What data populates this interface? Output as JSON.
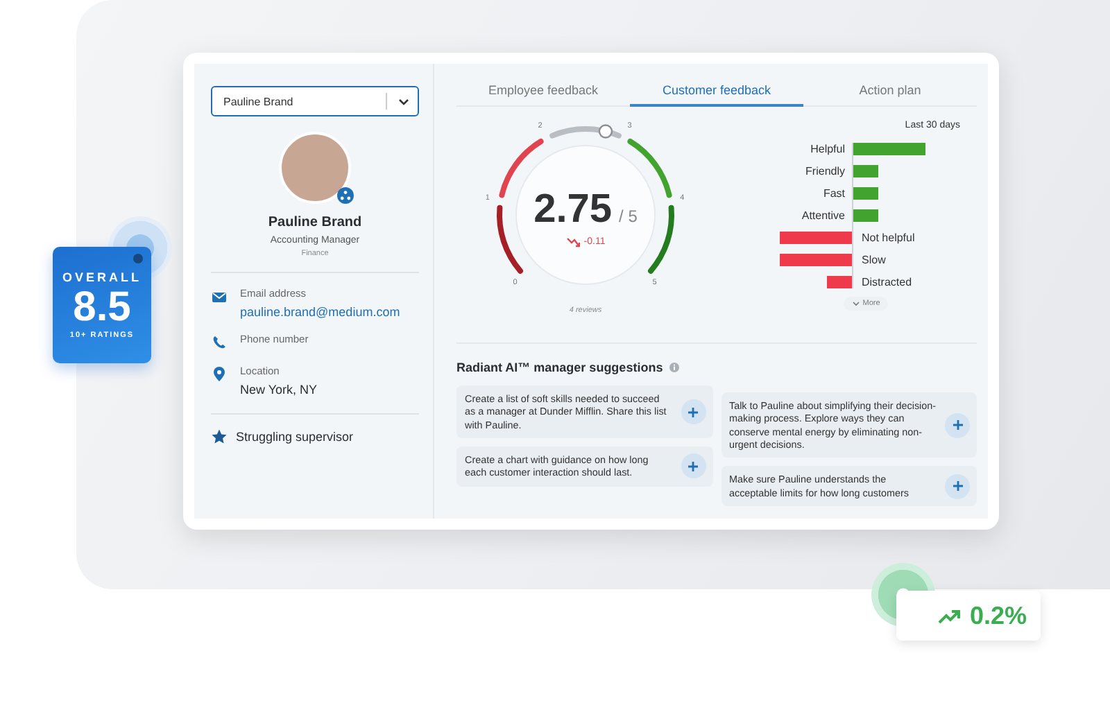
{
  "profile_picker": {
    "value": "Pauline Brand"
  },
  "profile": {
    "name": "Pauline Brand",
    "title": "Accounting Manager",
    "department": "Finance"
  },
  "contacts": [
    {
      "kind": "email",
      "label": "Email address",
      "value": "pauline.brand@medium.com"
    },
    {
      "kind": "phone",
      "label": "Phone number"
    },
    {
      "kind": "location",
      "label": "Location",
      "value": "New York, NY"
    }
  ],
  "flag": {
    "label": "Struggling supervisor"
  },
  "tabs": [
    {
      "label": "Employee feedback",
      "selected": false
    },
    {
      "label": "Customer feedback",
      "selected": true
    },
    {
      "label": "Action plan",
      "selected": false
    }
  ],
  "gauge": {
    "score": "2.75",
    "max": "/ 5",
    "level": 0.55,
    "change": "-0.11",
    "reviews": "4 reviews",
    "ticks": [
      "0",
      "1",
      "2",
      "3",
      "4",
      "5"
    ]
  },
  "traits": {
    "period": "Last 30 days",
    "more": "More",
    "items": [
      {
        "label": "Helpful",
        "kind": "positive"
      },
      {
        "label": "Friendly",
        "kind": "positive"
      },
      {
        "label": "Fast",
        "kind": "positive"
      },
      {
        "label": "Attentive",
        "kind": "positive"
      },
      {
        "label": "Not helpful",
        "kind": "negative"
      },
      {
        "label": "Slow",
        "kind": "negative"
      },
      {
        "label": "Distracted",
        "kind": "negative"
      }
    ]
  },
  "suggestions": {
    "title": "Radiant AI™ manager suggestions",
    "columns": [
      [
        "Create a list of soft skills needed to succeed as a manager at Dunder Mifflin. Share this list with Pauline.",
        "Create a chart with guidance on how long each customer interaction should last."
      ],
      [
        "Talk to Pauline about simplifying their decision-making process. Explore ways they can conserve mental energy by eliminating non-urgent decisions.",
        "Make sure Pauline understands the acceptable limits for how long customers"
      ]
    ]
  },
  "overall": {
    "label": "OVERALL",
    "score": "8.5",
    "count": "10+ RATINGS"
  },
  "trend": {
    "value": "0.2%"
  }
}
